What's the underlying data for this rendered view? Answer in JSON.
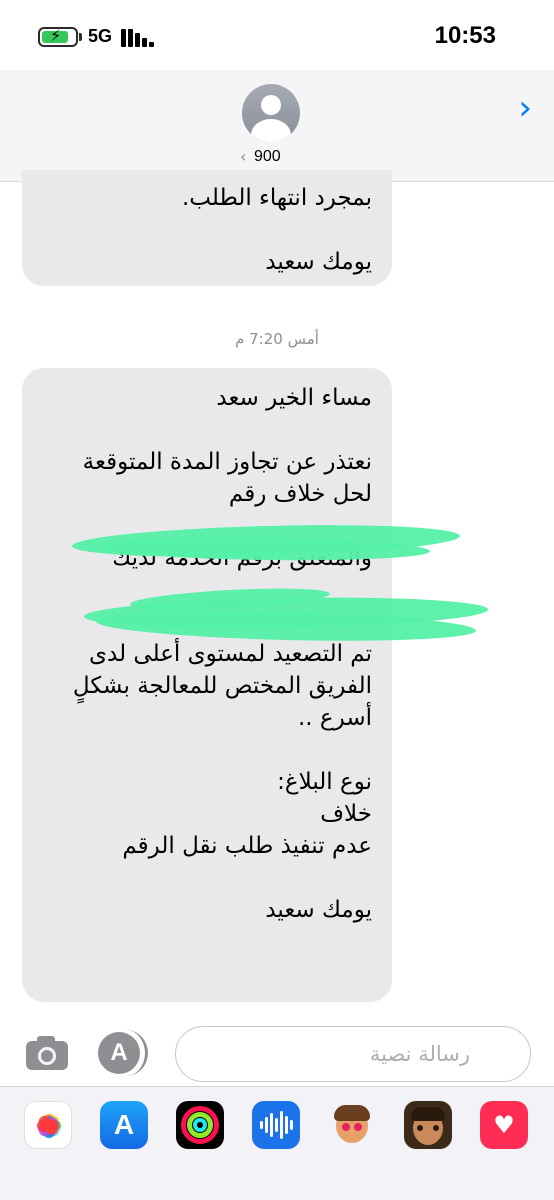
{
  "status_bar": {
    "time": "10:53",
    "network": "5G",
    "battery_level": 0.8,
    "battery_color": "#34c759"
  },
  "header": {
    "contact_name": "900",
    "back_chevron": "‹",
    "forward_chevron": "›",
    "avatar_icon": "person-placeholder-icon"
  },
  "messages": [
    {
      "direction": "incoming",
      "text": "بمجرد انتهاء الطلب.\n\nيومك سعيد"
    },
    {
      "direction": "incoming",
      "timestamp": "أمس 7:20 م",
      "text": "مساء الخير سعد\n\nنعتذر عن تجاوز المدة المتوقعة\nلحل خلاف رقم\n\nوالمتعلق برقم الخدمة لديك\n\n\nتم التصعيد لمستوى أعلى لدى\nالفريق المختص للمعالجة بشكلٍ\nأسرع ..\n\nنوع البلاغ:\nخلاف\nعدم تنفيذ طلب نقل الرقم\n\nيومك سعيد"
    }
  ],
  "composer": {
    "placeholder": "رسالة نصية",
    "camera_icon": "camera-icon",
    "apps_icon": "app-store-icon"
  },
  "app_drawer": {
    "apps": [
      "photos-icon",
      "app-store-icon",
      "activity-icon",
      "audio-message-icon",
      "memoji-icon",
      "memoji-icon",
      "digital-touch-icon"
    ]
  },
  "colors": {
    "bubble_incoming": "#e9e9eb",
    "accent": "#007aff",
    "redaction": "#55f0a8"
  }
}
